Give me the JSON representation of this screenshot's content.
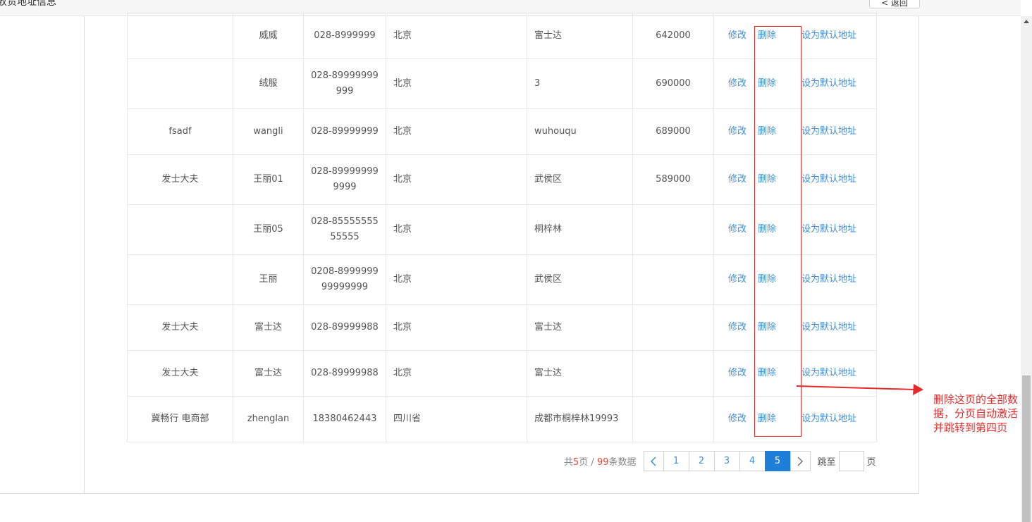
{
  "header": {
    "title": "收货地址信息",
    "back_label": "< 返回"
  },
  "table": {
    "action_labels": {
      "edit": "修改",
      "delete": "删除",
      "set_default": "设为默认地址"
    },
    "rows": [
      {
        "company": "",
        "name": "威威",
        "phone": "028-8999999",
        "province": "北京",
        "address": "富士达",
        "zip": "642000"
      },
      {
        "company": "",
        "name": "绒服",
        "phone": "028-89999999999",
        "province": "北京",
        "address": "3",
        "zip": "690000"
      },
      {
        "company": "fsadf",
        "name": "wangli",
        "phone": "028-89999999",
        "province": "北京",
        "address": "wuhouqu",
        "zip": "689000"
      },
      {
        "company": "发士大夫",
        "name": "王丽01",
        "phone": "028-899999999999",
        "province": "北京",
        "address": "武侯区",
        "zip": "589000"
      },
      {
        "company": "",
        "name": "王丽05",
        "phone": "028-8555555555555",
        "province": "北京",
        "address": "桐梓林",
        "zip": ""
      },
      {
        "company": "",
        "name": "王丽",
        "phone": "0208-899999999999999",
        "province": "北京",
        "address": "武侯区",
        "zip": ""
      },
      {
        "company": "发士大夫",
        "name": "富士达",
        "phone": "028-89999988",
        "province": "北京",
        "address": "富士达",
        "zip": ""
      },
      {
        "company": "发士大夫",
        "name": "富士达",
        "phone": "028-89999988",
        "province": "北京",
        "address": "富士达",
        "zip": ""
      },
      {
        "company": "冀畅行 电商部",
        "name": "zhenglan",
        "phone": "18380462443",
        "province": "四川省",
        "address": "成都市桐梓林19993",
        "zip": ""
      }
    ]
  },
  "pagination": {
    "total_prefix": "共",
    "total_pages": "5",
    "pages_suffix": "页 / ",
    "total_records": "99",
    "records_suffix": "条数据",
    "pages": [
      "1",
      "2",
      "3",
      "4",
      "5"
    ],
    "active_page": "5",
    "prev_icon": "chevron-left-icon",
    "next_icon": "chevron-right-icon",
    "jump_label": "跳至",
    "page_label": "页"
  },
  "annotation": {
    "lines": [
      "删除这页的全部数",
      "据，分页自动激活",
      "并跳转到第四页"
    ],
    "color": "#e32b2b"
  },
  "colors": {
    "link": "#3d8fd9",
    "active_page": "#1f7fd8",
    "annotation": "#e32b2b"
  }
}
